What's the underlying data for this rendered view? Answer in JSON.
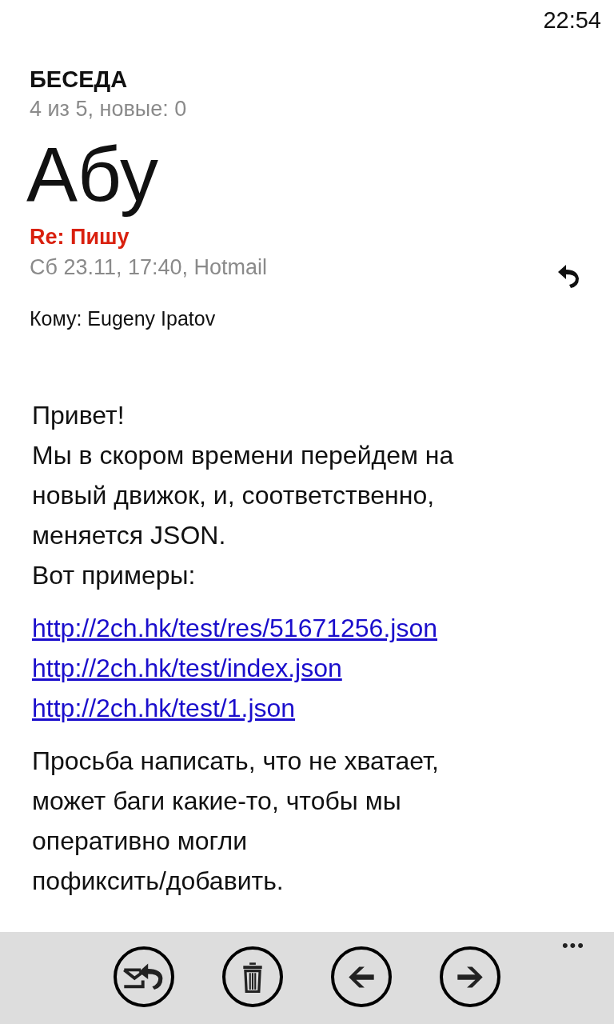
{
  "status_bar": {
    "time": "22:54"
  },
  "header": {
    "title": "БЕСЕДА",
    "subtitle": "4 из 5, новые: 0"
  },
  "message": {
    "sender": "Абу",
    "subject": "Re: Пишу",
    "meta": "Сб 23.11, 17:40, Hotmail",
    "to": "Кому: Eugeny Ipatov",
    "body": [
      {
        "kind": "text",
        "lines": [
          "Привет!",
          "Мы в скором времени перейдем на",
          "новый движок, и, соответственно,",
          "меняется JSON.",
          "Вот примеры:"
        ]
      },
      {
        "kind": "links",
        "lines": [
          "http://2ch.hk/test/res/51671256.json",
          "http://2ch.hk/test/index.json",
          "http://2ch.hk/test/1.json"
        ]
      },
      {
        "kind": "text",
        "lines": [
          "Просьба написать, что не хватает,",
          "может баги какие-то, чтобы мы",
          "оперативно могли",
          "пофиксить/добавить."
        ]
      }
    ]
  },
  "app_bar": {
    "buttons": [
      {
        "kind": "reply-all"
      },
      {
        "kind": "delete"
      },
      {
        "kind": "previous"
      },
      {
        "kind": "next"
      }
    ],
    "more": "•••"
  }
}
